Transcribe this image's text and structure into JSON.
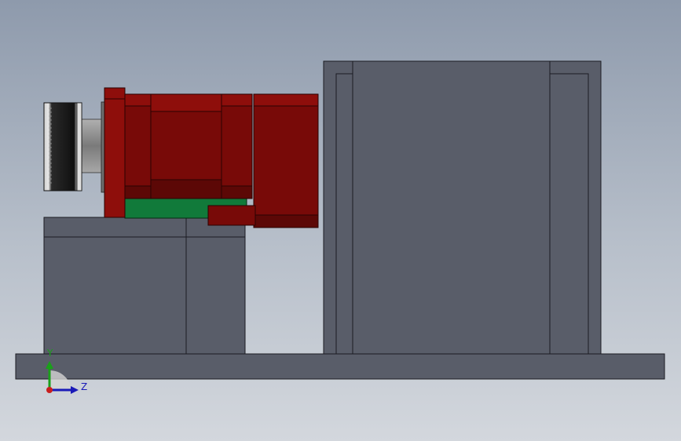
{
  "triad": {
    "y_label": "Y",
    "z_label": "Z",
    "y_color": "#1aa01a",
    "z_color": "#1a1ab8",
    "origin_color": "#c81e1e"
  },
  "colors": {
    "housing": "#595d69",
    "housing_edge": "#1c1c22",
    "motor_red": "#780a08",
    "motor_red_light": "#8e0e0b",
    "motor_red_dark": "#5c0806",
    "mount_green": "#117a3a",
    "coupling_dark": "#151515",
    "shaft_grey": "#8c8c8c"
  }
}
